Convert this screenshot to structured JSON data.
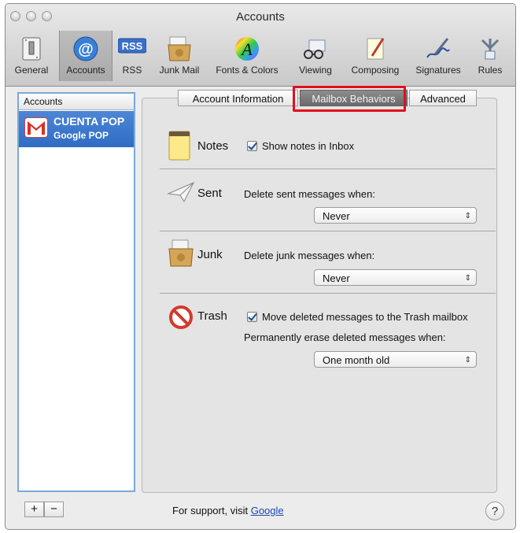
{
  "window": {
    "title": "Accounts"
  },
  "toolbar": {
    "items": [
      {
        "label": "General",
        "icon": "switch-icon"
      },
      {
        "label": "Accounts",
        "icon": "at-icon",
        "selected": true
      },
      {
        "label": "RSS",
        "icon": "rss-icon"
      },
      {
        "label": "Junk Mail",
        "icon": "junk-mail-icon"
      },
      {
        "label": "Fonts & Colors",
        "icon": "fonts-colors-icon"
      },
      {
        "label": "Viewing",
        "icon": "viewing-icon"
      },
      {
        "label": "Composing",
        "icon": "composing-icon"
      },
      {
        "label": "Signatures",
        "icon": "signatures-icon"
      },
      {
        "label": "Rules",
        "icon": "rules-icon"
      }
    ]
  },
  "accounts_list": {
    "header": "Accounts",
    "account": {
      "name": "CUENTA POP",
      "type": "Google POP"
    }
  },
  "tabs": [
    {
      "label": "Account Information"
    },
    {
      "label": "Mailbox Behaviors",
      "selected": true
    },
    {
      "label": "Advanced"
    }
  ],
  "notes": {
    "label": "Notes",
    "checkbox_label": "Show notes in Inbox",
    "checked": true
  },
  "sent": {
    "label": "Sent",
    "prompt": "Delete sent messages when:",
    "value": "Never"
  },
  "junk": {
    "label": "Junk",
    "prompt": "Delete junk messages when:",
    "value": "Never"
  },
  "trash": {
    "label": "Trash",
    "checkbox_label": "Move deleted messages to the Trash mailbox",
    "checked": true,
    "prompt": "Permanently erase deleted messages when:",
    "value": "One month old"
  },
  "footer": {
    "support_text": "For support, visit",
    "support_link": "Google",
    "add": "+",
    "remove": "−",
    "help": "?"
  },
  "colors": {
    "highlight": "#e0101a",
    "selection": "#2e6cc4"
  }
}
